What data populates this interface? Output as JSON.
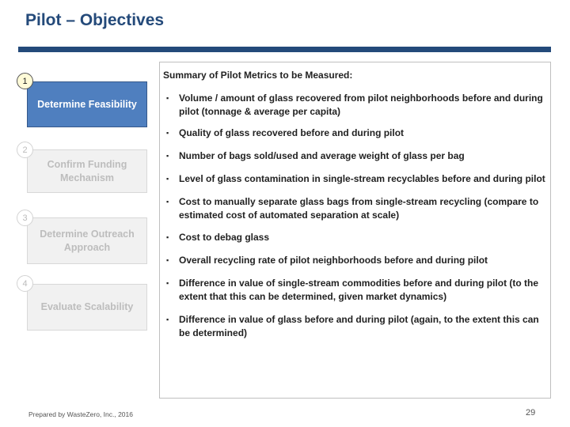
{
  "header": {
    "title": "Pilot – Objectives"
  },
  "steps": [
    {
      "number": "1",
      "label": "Determine Feasibility",
      "state": "active"
    },
    {
      "number": "2",
      "label": "Confirm Funding Mechanism",
      "state": "inactive"
    },
    {
      "number": "3",
      "label": "Determine Outreach Approach",
      "state": "inactive"
    },
    {
      "number": "4",
      "label": "Evaluate Scalability",
      "state": "inactive"
    }
  ],
  "panel": {
    "title": "Summary of Pilot Metrics to be Measured:",
    "bullet_glyph": "▪",
    "metrics": [
      "Volume / amount of glass recovered from pilot neighborhoods before and during pilot (tonnage & average per capita)",
      "Quality of glass recovered before and during pilot",
      "Number of bags sold/used and average weight of glass per bag",
      "Level of glass contamination in single-stream recyclables before and during pilot",
      "Cost to manually separate glass bags from single-stream recycling (compare to estimated cost of automated separation at scale)",
      "Cost to debag glass",
      "Overall recycling rate of pilot neighborhoods before and during pilot",
      "Difference in value of single-stream commodities before and during pilot (to the extent that this can be determined, given market dynamics)",
      "Difference in value of glass before and during pilot (again, to the extent this can be determined)"
    ]
  },
  "footer": {
    "prepared_by": "Prepared by WasteZero, Inc., 2016",
    "page_number": "29"
  },
  "colors": {
    "brand_navy": "#244a7a",
    "active_step": "#4f7fbf",
    "inactive_step": "#f1f1f1"
  }
}
